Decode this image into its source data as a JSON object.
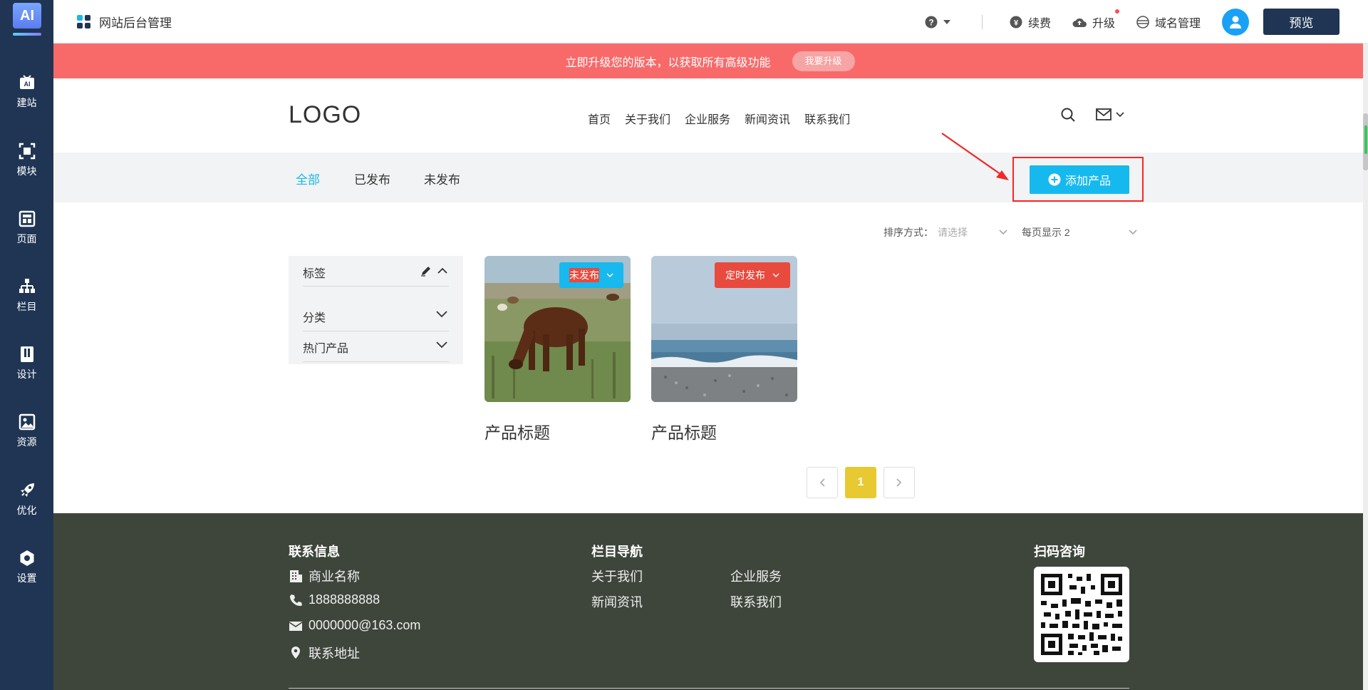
{
  "sidebar": {
    "logo_text": "AI",
    "items": [
      {
        "label": "建站",
        "icon": "ai-tv-icon"
      },
      {
        "label": "模块",
        "icon": "module-icon"
      },
      {
        "label": "页面",
        "icon": "page-icon"
      },
      {
        "label": "栏目",
        "icon": "sitemap-icon"
      },
      {
        "label": "设计",
        "icon": "design-icon"
      },
      {
        "label": "资源",
        "icon": "image-icon"
      },
      {
        "label": "优化",
        "icon": "rocket-icon"
      },
      {
        "label": "设置",
        "icon": "settings-icon"
      }
    ]
  },
  "topbar": {
    "title": "网站后台管理",
    "renew": "续费",
    "upgrade": "升级",
    "domain": "域名管理",
    "preview": "预览"
  },
  "banner": {
    "text": "立即升级您的版本，以获取所有高级功能",
    "button": "我要升级"
  },
  "site": {
    "logo": "LOGO",
    "nav": [
      "首页",
      "关于我们",
      "企业服务",
      "新闻资讯",
      "联系我们"
    ],
    "tabs": [
      "全部",
      "已发布",
      "未发布"
    ],
    "add_product": "添加产品",
    "sort_label": "排序方式：",
    "sort_placeholder": "请选择",
    "per_page": "每页显示 2",
    "filters": [
      "标签",
      "分类",
      "热门产品"
    ],
    "products": [
      {
        "title": "产品标题",
        "badge": "未发布",
        "badge_color": "#17b9ee"
      },
      {
        "title": "产品标题",
        "badge": "定时发布",
        "badge_color": "#e84a3e"
      }
    ],
    "page_current": "1"
  },
  "footer": {
    "contact_title": "联系信息",
    "company": "商业名称",
    "phone": "1888888888",
    "email": "0000000@163.com",
    "address": "联系地址",
    "nav_title": "栏目导航",
    "links": [
      "关于我们",
      "企业服务",
      "新闻资讯",
      "联系我们"
    ],
    "qr_title": "扫码咨询"
  },
  "colors": {
    "sidebar": "#1f3553",
    "banner": "#f86a6a",
    "accent": "#16b9ee",
    "footer": "#3e463c",
    "pager_active": "#e8c932"
  }
}
